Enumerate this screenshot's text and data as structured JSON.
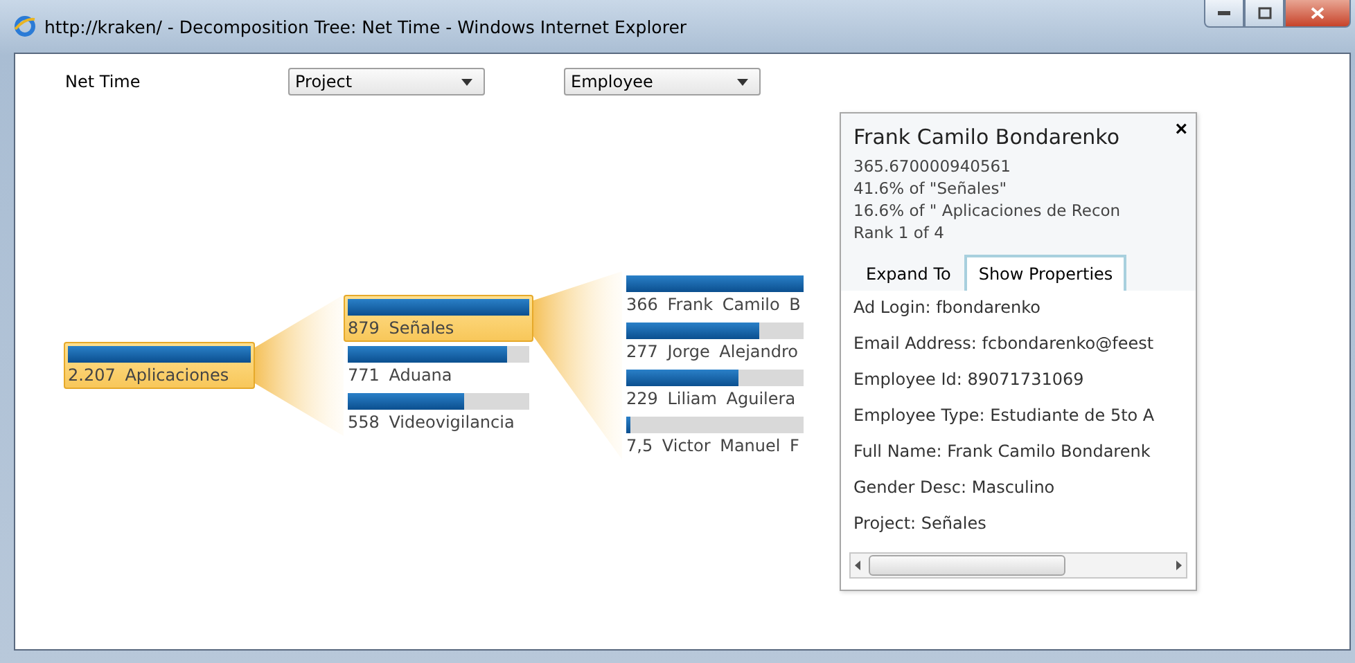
{
  "window": {
    "title": "http://kraken/ - Decomposition Tree: Net Time - Windows Internet Explorer"
  },
  "measure": "Net Time",
  "levels": [
    {
      "label": "Project"
    },
    {
      "label": "Employee"
    }
  ],
  "tree": {
    "value": "2.207",
    "label": "Aplicaciones",
    "level": 1,
    "selected": true,
    "children": [
      {
        "value": "879",
        "label": "Señales",
        "level": 1,
        "selected": true,
        "children": [
          {
            "value": "366",
            "label": "Frank Camilo B",
            "level": 1,
            "selected": false
          },
          {
            "value": "277",
            "label": "Jorge Alejandro",
            "level": 0.75,
            "selected": false
          },
          {
            "value": "229",
            "label": "Liliam Aguilera",
            "level": 0.63,
            "selected": false
          },
          {
            "value": "7,5",
            "label": "Victor Manuel F",
            "level": 0.02,
            "selected": false
          }
        ]
      },
      {
        "value": "771",
        "label": "Aduana",
        "level": 0.88,
        "selected": false
      },
      {
        "value": "558",
        "label": "Videovigilancia",
        "level": 0.64,
        "selected": false
      }
    ]
  },
  "popup": {
    "title": "Frank Camilo Bondarenko",
    "close": "×",
    "lines": [
      "365.670000940561",
      "41.6% of \"Señales\"",
      "16.6% of \" Aplicaciones de Recon",
      "Rank 1 of 4"
    ],
    "tabs": [
      {
        "label": "Expand To",
        "selected": false
      },
      {
        "label": "Show Properties",
        "selected": true
      }
    ],
    "properties": [
      "Ad Login: fbondarenko",
      "Email Address: fcbondarenko@feest",
      "Employee Id: 89071731069",
      "Employee Type: Estudiante de 5to A",
      "Full Name: Frank Camilo Bondarenk",
      "Gender Desc: Masculino",
      "Project: Señales"
    ]
  }
}
